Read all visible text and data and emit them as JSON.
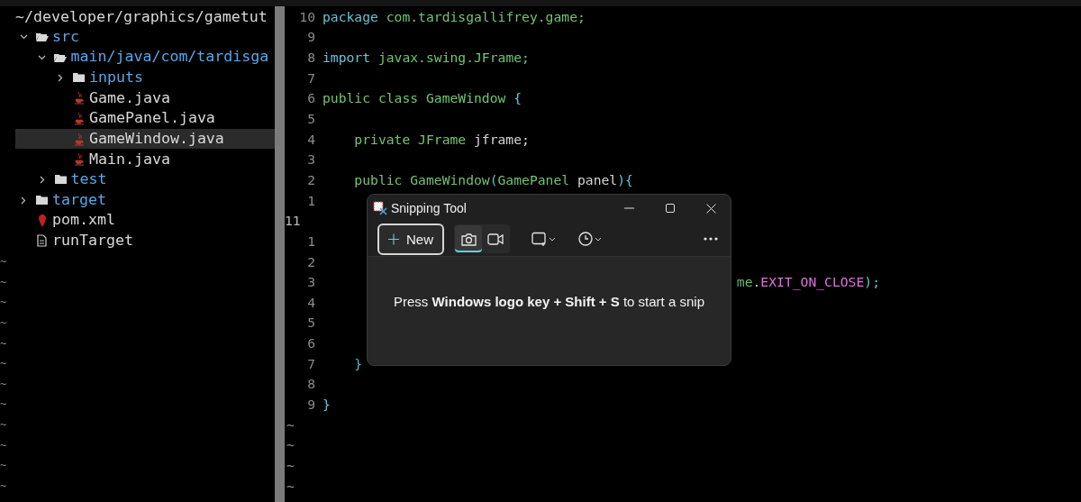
{
  "sidebar": {
    "root": "~/developer/graphics/gametut",
    "items": [
      {
        "label": "src",
        "kind": "folder",
        "expanded": true,
        "selected": false,
        "children": [
          {
            "label": "main/java/com/tardisga",
            "kind": "folder",
            "expanded": true,
            "selected": false,
            "children": [
              {
                "label": "inputs",
                "kind": "folder",
                "expanded": false,
                "selected": false
              },
              {
                "label": "Game.java",
                "kind": "java",
                "selected": false
              },
              {
                "label": "GamePanel.java",
                "kind": "java",
                "selected": false
              },
              {
                "label": "GameWindow.java",
                "kind": "java",
                "selected": true
              },
              {
                "label": "Main.java",
                "kind": "java",
                "selected": false
              }
            ]
          },
          {
            "label": "test",
            "kind": "folder",
            "expanded": false,
            "selected": false
          }
        ]
      },
      {
        "label": "target",
        "kind": "folder",
        "expanded": false,
        "selected": false
      },
      {
        "label": "pom.xml",
        "kind": "maven",
        "selected": false
      },
      {
        "label": "runTarget",
        "kind": "text",
        "selected": false
      }
    ],
    "filler_lines": [
      "~",
      "~",
      "~",
      "~",
      "~",
      "~",
      "~",
      "~",
      "~",
      "~",
      "~",
      "~"
    ]
  },
  "editor": {
    "lines": [
      {
        "number": "10",
        "current": false,
        "indented": false,
        "clipped_start": false,
        "tokens": [
          {
            "text": "package",
            "kind": "keyword"
          },
          {
            "text": " com.tardisgallifrey.game;",
            "kind": "name"
          }
        ]
      },
      {
        "number": "9",
        "current": false
      },
      {
        "number": "8",
        "current": false,
        "indented": false,
        "clipped_start": false,
        "tokens": [
          {
            "text": "import",
            "kind": "keyword"
          },
          {
            "text": " javax.swing.JFrame;",
            "kind": "name"
          }
        ]
      },
      {
        "number": "7",
        "current": false
      },
      {
        "number": "6",
        "current": false,
        "indented": false,
        "clipped_start": false,
        "tokens": [
          {
            "text": "public class GameWindow ",
            "kind": "name"
          },
          {
            "text": "{",
            "kind": "punct"
          }
        ]
      },
      {
        "number": "5",
        "current": false
      },
      {
        "number": "4",
        "current": false,
        "indented": true,
        "clipped_start": false,
        "tokens": [
          {
            "text": "private JFrame ",
            "kind": "name"
          },
          {
            "text": "jframe;",
            "kind": "variable"
          }
        ]
      },
      {
        "number": "3",
        "current": false
      },
      {
        "number": "2",
        "current": false,
        "indented": true,
        "clipped_start": false,
        "tokens": [
          {
            "text": "public GameWindow",
            "kind": "name"
          },
          {
            "text": "(",
            "kind": "punct"
          },
          {
            "text": "GamePanel ",
            "kind": "name"
          },
          {
            "text": "panel",
            "kind": "variable"
          },
          {
            "text": "){",
            "kind": "punct"
          }
        ]
      },
      {
        "number": "1",
        "current": false
      },
      {
        "number": "11",
        "current": true
      },
      {
        "number": "1",
        "current": false
      },
      {
        "number": "2",
        "current": false
      },
      {
        "number": "3",
        "current": false,
        "indented": true,
        "clipped_start": true,
        "tokens": [
          {
            "text": "me",
            "kind": "name"
          },
          {
            "text": ".",
            "kind": "variable"
          },
          {
            "text": "EXIT_ON_CLOSE",
            "kind": "constant"
          },
          {
            "text": ");",
            "kind": "punct"
          }
        ]
      },
      {
        "number": "4",
        "current": false
      },
      {
        "number": "5",
        "current": false
      },
      {
        "number": "6",
        "current": false
      },
      {
        "number": "7",
        "current": false,
        "indented": true,
        "clipped_start": false,
        "tokens": [
          {
            "text": "}",
            "kind": "punct"
          }
        ]
      },
      {
        "number": "8",
        "current": false
      },
      {
        "number": "9",
        "current": false,
        "indented": false,
        "clipped_start": false,
        "tokens": [
          {
            "text": "}",
            "kind": "punct"
          }
        ]
      }
    ],
    "filler_lines": [
      "~",
      "~",
      "~",
      "~"
    ]
  },
  "snipping_tool": {
    "title": "Snipping Tool",
    "new_button": "New",
    "modes": [
      {
        "kind": "photo",
        "selected": true
      },
      {
        "kind": "video",
        "selected": false
      }
    ],
    "message": "Press **Windows logo key + Shift + S** to start a snip"
  }
}
